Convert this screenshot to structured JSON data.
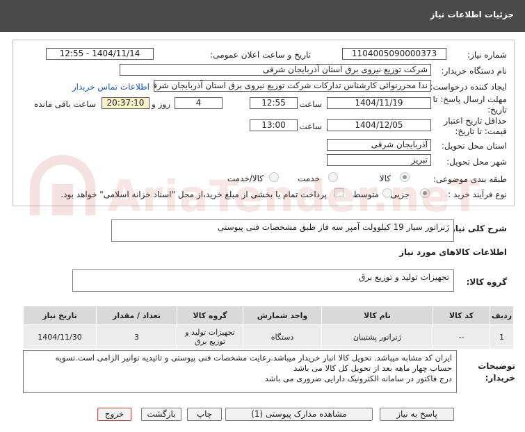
{
  "header": {
    "title": "جزئیات اطلاعات نیاز"
  },
  "fields": {
    "need_number_label": "شماره نیاز:",
    "need_number": "1104005090000373",
    "announce_label": "تاریخ و ساعت اعلان عمومی:",
    "announce_value": "1404/11/14 - 12:55",
    "buyer_label": "نام دستگاه خریدار:",
    "buyer_value": "شرکت توزیع نیروی برق استان آذربایجان شرقی",
    "requester_label": "ایجاد کننده درخواست:",
    "requester_value": "ندا محررنوائی کارشناس تدارکات شرکت توزیع نیروی برق استان آذربایجان شرقی",
    "contact_link": "اطلاعات تماس خریدار",
    "deadline_label_1": "مهلت ارسال پاسخ: تا",
    "deadline_label_2": "تاریخ:",
    "deadline_date": "1404/11/19",
    "time_label": "ساعت",
    "deadline_time": "12:55",
    "days_value": "4",
    "days_label": "روز و",
    "remaining_time": "20:37:10",
    "remaining_label": "ساعت باقی مانده",
    "validity_label_1": "حداقل تاریخ اعتبار",
    "validity_label_2": "قیمت: تا تاریخ:",
    "validity_date": "1404/12/05",
    "validity_time_label": "ساعت",
    "validity_time": "13:00",
    "province_label": "استان محل تحویل:",
    "province_value": "آذربایجان شرقی",
    "city_label": "شهر محل تحویل:",
    "city_value": "تبریز",
    "category_label": "طبقه بندی موضوعی:",
    "category_options": [
      "کالا",
      "خدمت",
      "کالا/خدمت"
    ],
    "category_selected": "کالا",
    "process_label": "نوع فرآیند خرید :",
    "process_options": [
      "جزیی",
      "متوسط"
    ],
    "process_selected": "جزیی",
    "payment_note": "پرداخت تمام یا بخشی از مبلغ خرید،از محل \"اسناد خزانه اسلامی\" خواهد بود."
  },
  "description": {
    "label": "شرح کلی نیاز:",
    "value": "ژنراتور سیار 19 کیلوولت آمپر سه فاز طبق مشخصات فنی پیوستی"
  },
  "goods_section": {
    "title": "اطلاعات کالاهای مورد نیاز"
  },
  "goods_group": {
    "label": "گروه کالا:",
    "value": "تجهیزات تولید و توزیع برق"
  },
  "table": {
    "headers": [
      "ردیف",
      "کد کالا",
      "نام کالا",
      "واحد شمارش",
      "گروه کالا",
      "تعداد / مقدار",
      "تاریخ نیاز"
    ],
    "rows": [
      {
        "row": "1",
        "code": "--",
        "name": "ژنراتور پشتیبان",
        "unit": "دستگاه",
        "group": "تجهیزات تولید و توزیع برق",
        "qty": "3",
        "date": "1404/11/30"
      }
    ]
  },
  "buyer_notes": {
    "label_1": "توضیحات",
    "label_2": "خریدار:",
    "lines": [
      "ایران کد مشابه میباشد. تحویل کالا انبار خریدار میباشد.رعایت مشخصات فنی پیوستی و تائیدیه توانیر الزامی است.تسویه",
      "حساب چهار ماهه بعد از تحویل کل کالا می باشد",
      "درج فاکتور در سامانه الکترونیک دارایی ضروری می باشد"
    ]
  },
  "buttons": {
    "reply": "پاسخ به نیاز",
    "attachments": "مشاهده مدارک پیوستی (1)",
    "print": "چاپ",
    "back": "بازگشت",
    "exit": "خروج"
  },
  "watermark": {
    "text": "AriaTender.neT"
  },
  "colors": {
    "header_bg": "#4a4a4a",
    "link": "#1a56c4",
    "remaining_bg": "#f6f1c7",
    "exit_border": "#c44",
    "watermark": "#c0392b"
  }
}
